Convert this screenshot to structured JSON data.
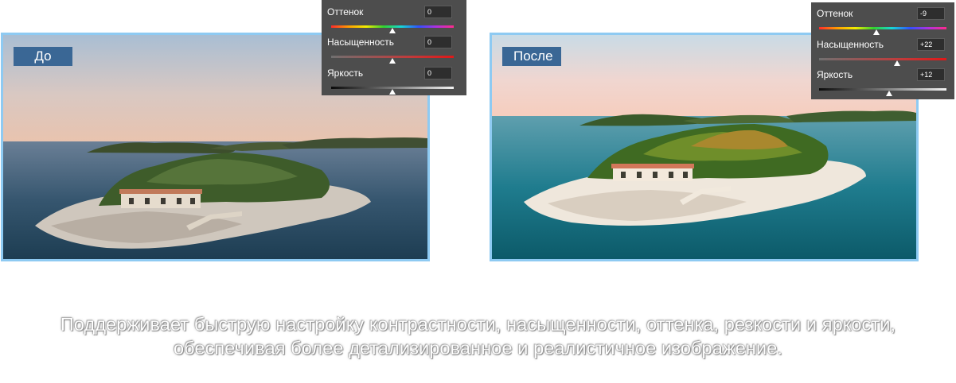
{
  "before": {
    "label": "До",
    "label_color": "#3a6795",
    "frame_color": "#8ecaf2",
    "adjustments": [
      {
        "name": "Оттенок",
        "value": "0",
        "level": 0.5,
        "track": "hue"
      },
      {
        "name": "Насыщенность",
        "value": "0",
        "level": 0.5,
        "track": "saturation"
      },
      {
        "name": "Яркость",
        "value": "0",
        "level": 0.5,
        "track": "brightness"
      }
    ]
  },
  "after": {
    "label": "После",
    "label_color": "#3a6795",
    "frame_color": "#8ecaf2",
    "adjustments": [
      {
        "name": "Оттенок",
        "value": "-9",
        "level": 0.45,
        "track": "hue"
      },
      {
        "name": "Насыщенность",
        "value": "+22",
        "level": 0.61,
        "track": "saturation"
      },
      {
        "name": "Яркость",
        "value": "+12",
        "level": 0.55,
        "track": "brightness"
      }
    ]
  },
  "caption": {
    "line1": "Поддерживает быструю настройку контрастности, насыщенности, оттенка, резкости и яркости,",
    "line2": "обеспечивая более детализированное и реалистичное изображение."
  },
  "panel_color": "#4d4d4d"
}
